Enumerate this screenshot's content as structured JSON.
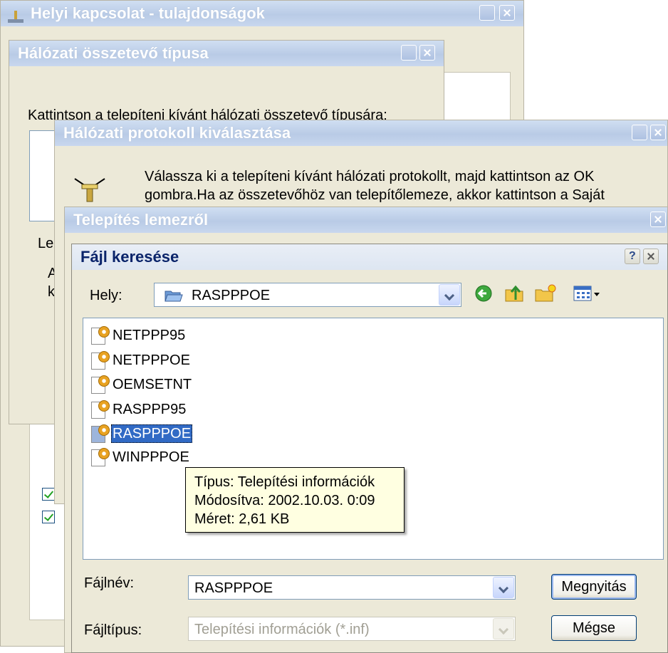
{
  "window1": {
    "title": "Helyi kapcsolat - tulajdonságok"
  },
  "window2": {
    "title": "Hálózati összetevő típusa",
    "instruction": "Kattintson a telepíteni kívánt hálózati összetevő típusára:",
    "group_label_fragment": "Le",
    "description_fragment_1": "A",
    "description_fragment_2": "k"
  },
  "window3": {
    "title": "Hálózati protokoll kiválasztása",
    "instruction_line1": "Válassza ki a telepíteni kívánt hálózati protokollt, majd kattintson az OK",
    "instruction_line2": "gombra.Ha az összetevőhöz van telepítőlemeze, akkor kattintson a Saját"
  },
  "window4": {
    "title": "Telepítés lemezről"
  },
  "dialog": {
    "title": "Fájl keresése",
    "location_label": "Hely:",
    "location_value": "RASPPPOE",
    "files": [
      {
        "name": "NETPPP95",
        "selected": false
      },
      {
        "name": "NETPPPOE",
        "selected": false
      },
      {
        "name": "OEMSETNT",
        "selected": false
      },
      {
        "name": "RASPPP95",
        "selected": false
      },
      {
        "name": "RASPPPOE",
        "selected": true
      },
      {
        "name": "WINPPPOE",
        "selected": false
      }
    ],
    "tooltip": {
      "line1": "Típus: Telepítési információk",
      "line2": "Módosítva: 2002.10.03. 0:09",
      "line3": "Méret: 2,61 KB"
    },
    "filename_label": "Fájlnév:",
    "filename_value": "RASPPPOE",
    "filetype_label": "Fájltípus:",
    "filetype_value": "Telepítési információk (*.inf)",
    "open_button": "Megnyitás",
    "cancel_button": "Mégse"
  },
  "icons": [
    "network-icon",
    "folder-icon",
    "back-icon",
    "up-folder-icon",
    "new-folder-icon",
    "view-menu-icon",
    "inf-file-icon",
    "protocol-icon"
  ]
}
